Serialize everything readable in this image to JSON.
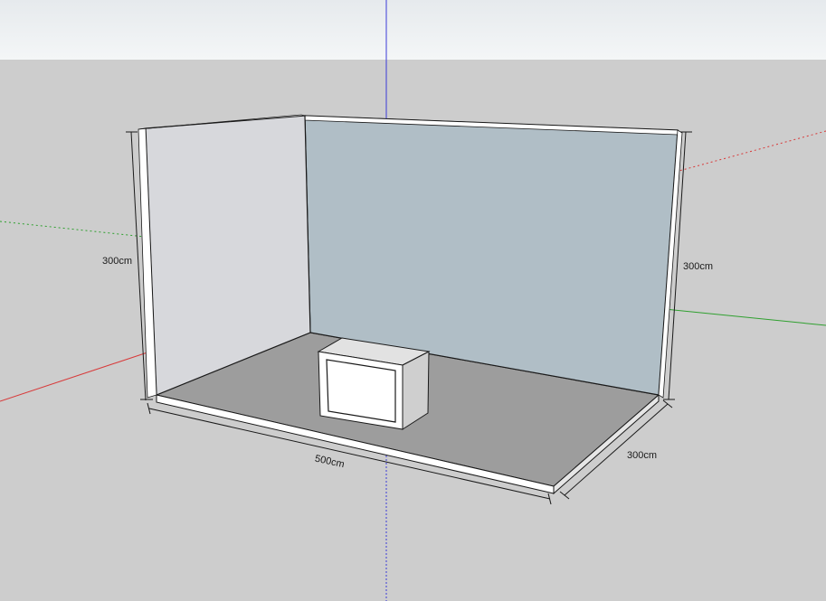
{
  "colors": {
    "sky_top": "#e6eaed",
    "sky_bottom": "#f4f6f7",
    "ground": "#cdcdcd",
    "floor": "#9d9d9d",
    "back_wall": "#b0bec6",
    "side_wall": "#d7d8dc",
    "wall_edge": "#1a1a1a",
    "axis_red": "#d83a3a",
    "axis_green": "#2fa02f",
    "axis_blue": "#3b3bd8",
    "cabinet_top": "#e2e2e2",
    "cabinet_front": "#ffffff",
    "cabinet_side": "#cfcfcf"
  },
  "dimensions": {
    "left_height": "300cm",
    "right_height": "300cm",
    "width": "500cm",
    "depth": "300cm"
  }
}
